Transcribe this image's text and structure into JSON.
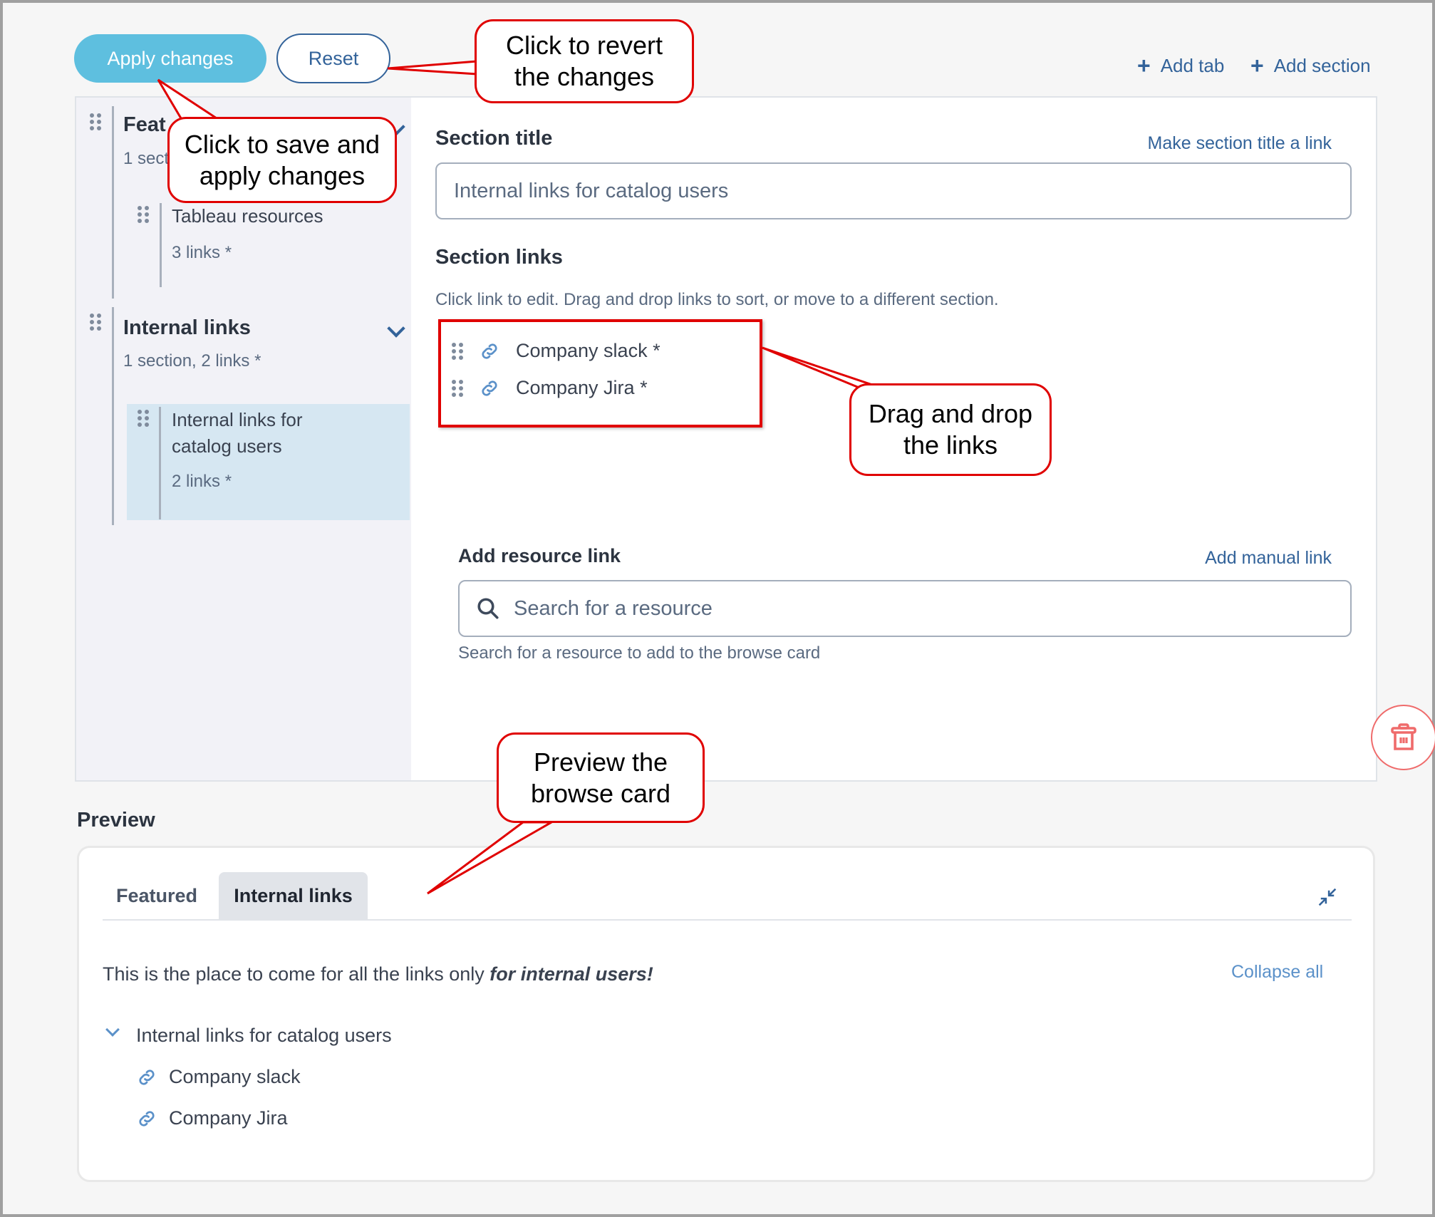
{
  "toolbar": {
    "apply_label": "Apply changes",
    "reset_label": "Reset",
    "add_tab_label": "Add tab",
    "add_section_label": "Add section",
    "plus_glyph": "+"
  },
  "sidebar": {
    "tabs": [
      {
        "title": "Featured",
        "title_visible": "Feat",
        "summary_visible": "1 sect",
        "sections": [
          {
            "title": "Tableau resources",
            "count": "3 links *"
          }
        ]
      },
      {
        "title": "Internal links",
        "summary": "1 section, 2 links *",
        "sections": [
          {
            "title": "Internal links for catalog users",
            "title_line1": "Internal links for",
            "title_line2": "catalog users",
            "count": "2 links *",
            "selected": true
          }
        ]
      }
    ]
  },
  "editor": {
    "section_title_label": "Section title",
    "make_link_label": "Make section title a link",
    "section_title_value": "Internal links for catalog users",
    "section_links_label": "Section links",
    "section_links_hint": "Click link to edit. Drag and drop links to sort, or move to a different section.",
    "links": [
      {
        "label": "Company slack *"
      },
      {
        "label": "Company Jira *"
      }
    ],
    "add_resource_label": "Add resource link",
    "add_manual_label": "Add manual link",
    "search_placeholder": "Search for a resource",
    "search_hint": "Search for a resource to add to the browse card"
  },
  "preview": {
    "title": "Preview",
    "tabs": [
      {
        "label": "Featured",
        "active": false
      },
      {
        "label": "Internal links",
        "active": true
      }
    ],
    "description_prefix": "This is the place to come for all the links only ",
    "description_emphasis": "for internal users!",
    "collapse_all_label": "Collapse all",
    "section_title": "Internal links for catalog users",
    "links": [
      "Company slack",
      "Company Jira"
    ]
  },
  "callouts": {
    "revert": "Click to revert\nthe changes",
    "save": "Click to save and\napply changes",
    "drag": "Drag and drop\nthe links",
    "preview": "Preview the\nbrowse card"
  },
  "colors": {
    "accent": "#33639a",
    "apply_button": "#5ebfdf",
    "selected_section": "#d6e7f2",
    "delete": "#ef6b6b",
    "callout_red": "#e00000"
  }
}
